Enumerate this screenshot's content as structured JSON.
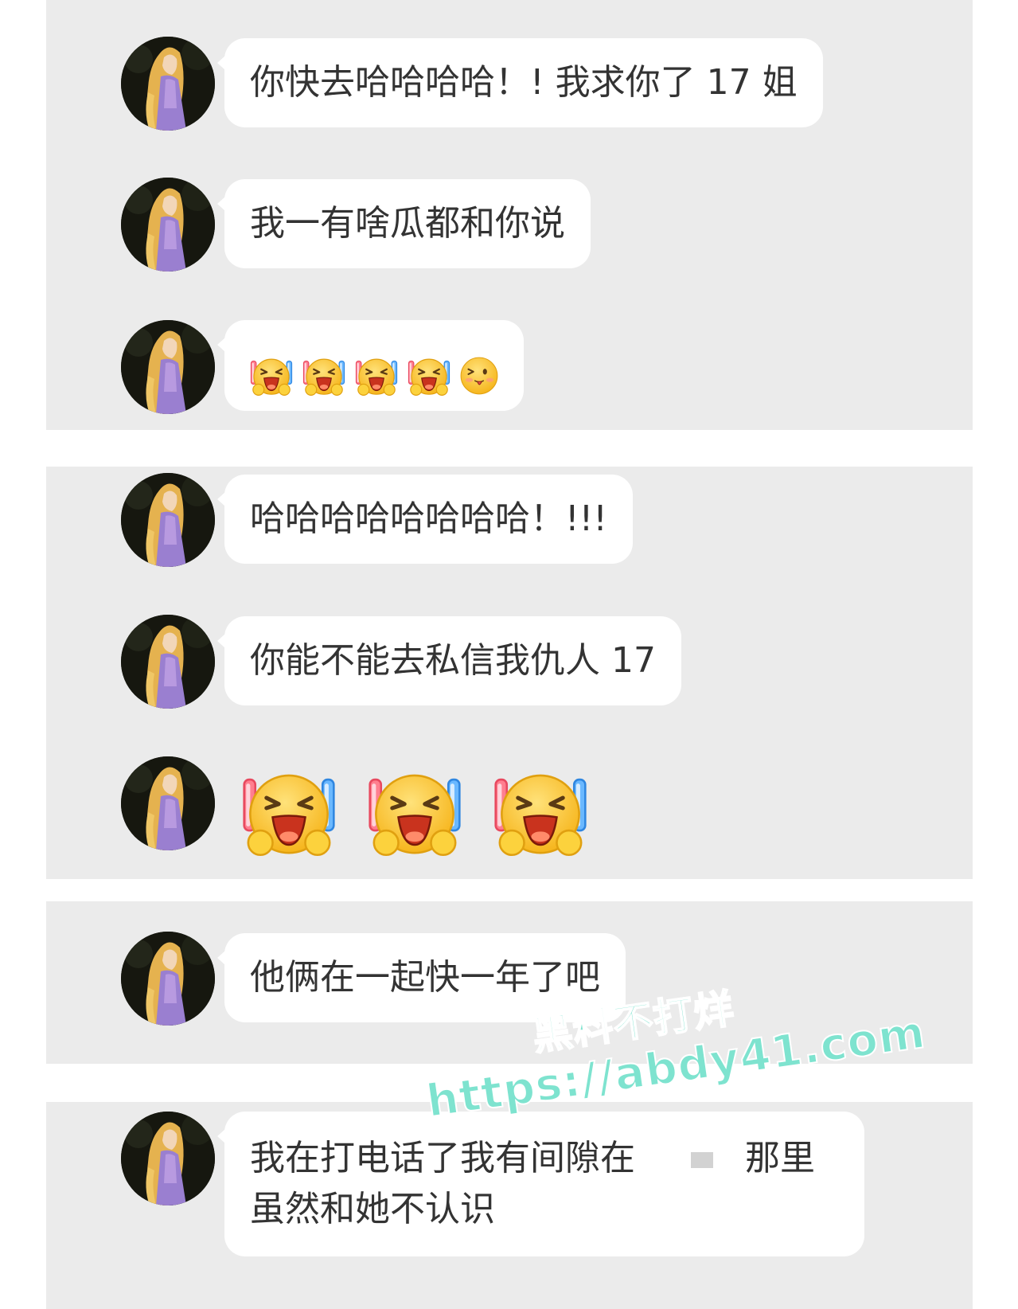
{
  "messages": [
    {
      "text": "你快去哈哈哈哈！! 我求你了 17 姐"
    },
    {
      "text": "我一有啥瓜都和你说"
    },
    {
      "emojis": [
        "laugh-cry-emoji",
        "laugh-cry-emoji",
        "laugh-cry-emoji",
        "laugh-cry-emoji",
        "wink-tongue-emoji"
      ]
    },
    {
      "text": "哈哈哈哈哈哈哈哈！!!!"
    },
    {
      "text": "你能不能去私信我仇人 17"
    },
    {
      "emojis": [
        "laugh-cry-emoji",
        "laugh-cry-emoji",
        "laugh-cry-emoji"
      ]
    },
    {
      "text": "他俩在一起快一年了吧"
    },
    {
      "line1_part1": "我在打电话了我有间隙在",
      "line1_part2": "那里",
      "line2": "虽然和她不认识"
    }
  ],
  "watermark": {
    "line1": "黑料不打烊",
    "line2": "https://abdy41.com",
    "color": "#7ee3cf"
  },
  "colors": {
    "panel_background": "#ebebeb",
    "bubble_background": "#ffffff",
    "text": "#333333"
  }
}
